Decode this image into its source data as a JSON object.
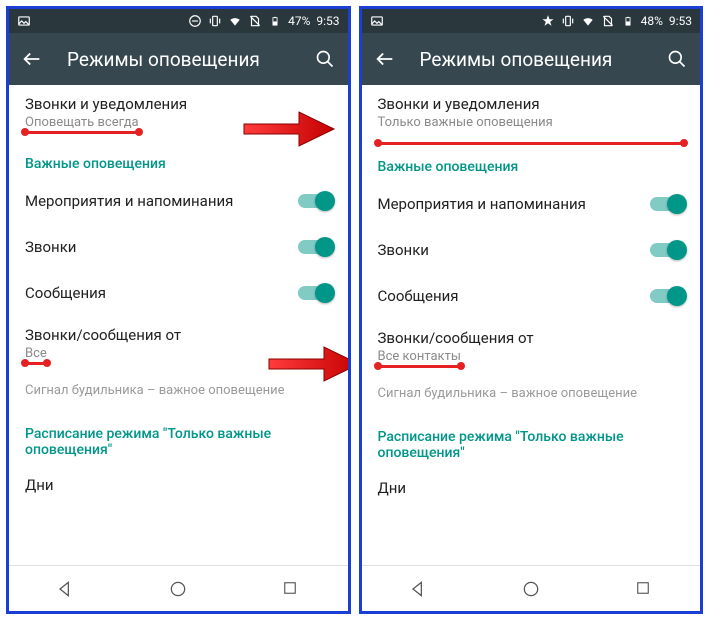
{
  "left": {
    "status": {
      "battery": "47%",
      "time": "9:53"
    },
    "appbar": {
      "title": "Режимы оповещения"
    },
    "calls_notif": {
      "title": "Звонки и уведомления",
      "subtitle": "Оповещать всегда"
    },
    "section_priority": "Важные оповещения",
    "toggles": {
      "events": "Мероприятия и напоминания",
      "calls": "Звонки",
      "messages": "Сообщения"
    },
    "from": {
      "title": "Звонки/сообщения от",
      "subtitle": "Все"
    },
    "footnote": "Сигнал будильника – важное оповещение",
    "section_schedule": "Расписание режима \"Только важные оповещения\"",
    "days": "Дни"
  },
  "right": {
    "status": {
      "battery": "48%",
      "time": "9:53"
    },
    "appbar": {
      "title": "Режимы оповещения"
    },
    "calls_notif": {
      "title": "Звонки и уведомления",
      "subtitle": "Только важные оповещения"
    },
    "section_priority": "Важные оповещения",
    "toggles": {
      "events": "Мероприятия и напоминания",
      "calls": "Звонки",
      "messages": "Сообщения"
    },
    "from": {
      "title": "Звонки/сообщения от",
      "subtitle": "Все контакты"
    },
    "footnote": "Сигнал будильника – важное оповещение",
    "section_schedule": "Расписание режима \"Только важные оповещения\"",
    "days": "Дни"
  }
}
